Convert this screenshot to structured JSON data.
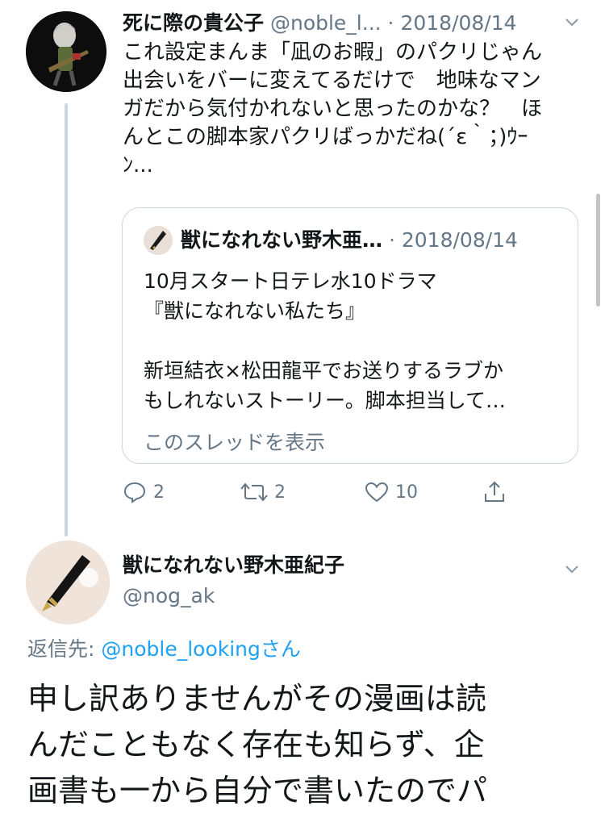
{
  "tweet1": {
    "display_name": "死に際の貴公子",
    "handle": "@noble_l...",
    "separator": "·",
    "date": "2018/08/14",
    "text_lines": [
      "これ設定まんま「凪のお暇」のパクリじゃん",
      "出会いをバーに変えてるだけで　地味なマン",
      "ガだから気付かれないと思ったのかな？　ほ",
      "んとこの脚本家パクリばっかだね(´ε｀；)ｳｰ",
      "ﾝ..."
    ],
    "quote": {
      "display_name": "獣になれない野木亜…",
      "separator": "·",
      "date": "2018/08/14",
      "text_lines": [
        "10月スタート日テレ水10ドラマ",
        "『獣になれない私たち』",
        "",
        "新垣結衣×松田龍平でお送りするラブか",
        "もしれないストーリー。脚本担当して…"
      ],
      "show_thread": "このスレッドを表示"
    },
    "actions": {
      "reply_count": "2",
      "retweet_count": "2",
      "like_count": "10"
    }
  },
  "tweet2": {
    "display_name": "獣になれない野木亜紀子",
    "handle": "@nog_ak",
    "reply_label": "返信先: ",
    "reply_user": "@noble_looking",
    "reply_suffix": "さん",
    "text_lines": [
      "申し訳ありませんがその漫画は読",
      "んだこともなく存在も知らず、企",
      "画書も一から自分で書いたのでパ"
    ]
  },
  "colors": {
    "accent": "#1da1f2",
    "secondary_text": "#657786",
    "border": "#ccd6dd"
  }
}
